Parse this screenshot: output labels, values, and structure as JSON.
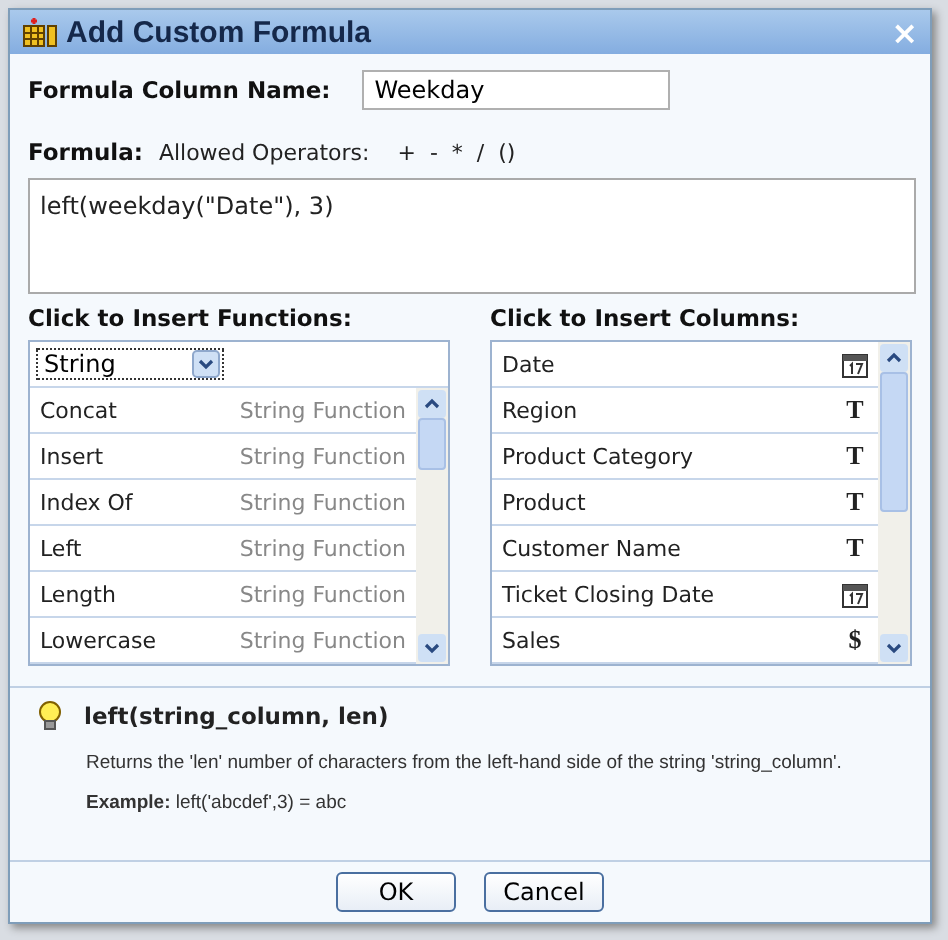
{
  "window": {
    "title": "Add Custom Formula",
    "close": "×"
  },
  "name_field": {
    "label": "Formula Column Name:",
    "value": "Weekday"
  },
  "formula": {
    "label": "Formula:",
    "operators_label": "Allowed Operators:",
    "operators": "+  -  *  /  ()",
    "value": "left(weekday(\"Date\"), 3)"
  },
  "functions": {
    "heading": "Click to Insert Functions:",
    "category": "String",
    "items": [
      {
        "name": "Concat",
        "type": "String Function"
      },
      {
        "name": "Insert",
        "type": "String Function"
      },
      {
        "name": "Index Of",
        "type": "String Function"
      },
      {
        "name": "Left",
        "type": "String Function"
      },
      {
        "name": "Length",
        "type": "String Function"
      },
      {
        "name": "Lowercase",
        "type": "String Function"
      }
    ]
  },
  "columns": {
    "heading": "Click to Insert Columns:",
    "items": [
      {
        "name": "Date",
        "kind": "date"
      },
      {
        "name": "Region",
        "kind": "text",
        "icon": "T"
      },
      {
        "name": "Product Category",
        "kind": "text",
        "icon": "T"
      },
      {
        "name": "Product",
        "kind": "text",
        "icon": "T"
      },
      {
        "name": "Customer Name",
        "kind": "text",
        "icon": "T"
      },
      {
        "name": "Ticket Closing Date",
        "kind": "date"
      },
      {
        "name": "Sales",
        "kind": "currency",
        "icon": "$"
      }
    ]
  },
  "help": {
    "signature": "left(string_column, len)",
    "description": "Returns the 'len' number of characters from the left-hand side of the string 'string_column'.",
    "example": "**Example:** left('abcdef',3) = abc"
  },
  "buttons": [
    "OK",
    "Cancel"
  ]
}
